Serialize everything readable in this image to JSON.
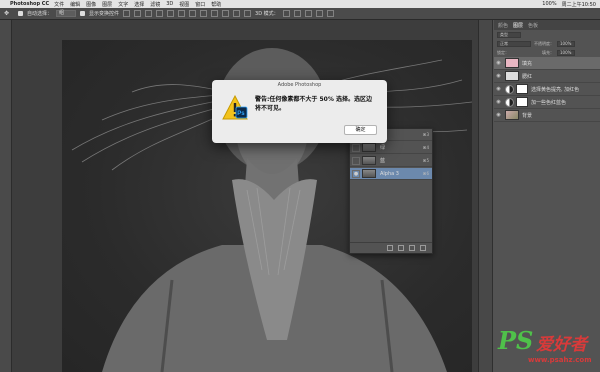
{
  "menubar": {
    "app_name": "Photoshop CC",
    "items": [
      "文件",
      "编辑",
      "图像",
      "图层",
      "文字",
      "选择",
      "滤镜",
      "3D",
      "视图",
      "窗口",
      "帮助"
    ],
    "battery": "100%",
    "clock": "周二上午10:50"
  },
  "options_bar": {
    "auto_select_label": "自动选择：",
    "auto_select_value": "组",
    "show_transform_label": "显示变换控件",
    "mode_3d_label": "3D 模式："
  },
  "channels_panel": {
    "rows": [
      {
        "name": "红",
        "key": "⌘3",
        "active": false
      },
      {
        "name": "绿",
        "key": "⌘4",
        "active": false
      },
      {
        "name": "蓝",
        "key": "⌘5",
        "active": false
      },
      {
        "name": "Alpha 3",
        "key": "⌘6",
        "active": true
      }
    ]
  },
  "layers_panel": {
    "tabs": [
      "颜色",
      "图层",
      "色板"
    ],
    "active_tab": "图层",
    "kind_filter": "类型",
    "blend_mode": "正常",
    "opacity_label": "不透明度：",
    "opacity_value": "100%",
    "lock_label": "锁定：",
    "fill_label": "填充：",
    "fill_value": "100%",
    "layers": [
      {
        "name": "填充",
        "thumb": "pink",
        "type": "pixel",
        "active": true
      },
      {
        "name": "腮红",
        "thumb": "white",
        "type": "pixel",
        "active": false
      },
      {
        "name": "选择黄色提亮, 加红色",
        "thumb": "adjust",
        "type": "adjustment",
        "active": false
      },
      {
        "name": "加一些色红蓝色",
        "thumb": "adjust",
        "type": "adjustment",
        "active": false
      },
      {
        "name": "背景",
        "thumb": "photo",
        "type": "background",
        "active": false
      }
    ]
  },
  "dialog": {
    "title": "Adobe Photoshop",
    "message": "警告:任何像素都不大于 50% 选择。选区边将不可见。",
    "ok_label": "确定"
  },
  "watermark": {
    "logo": "PS",
    "brand": "爱好者",
    "url": "www.psahz.com"
  },
  "colors": {
    "accent_green": "#4fc14a",
    "accent_red": "#d83a3a",
    "selection_blue": "#6c89ad"
  }
}
